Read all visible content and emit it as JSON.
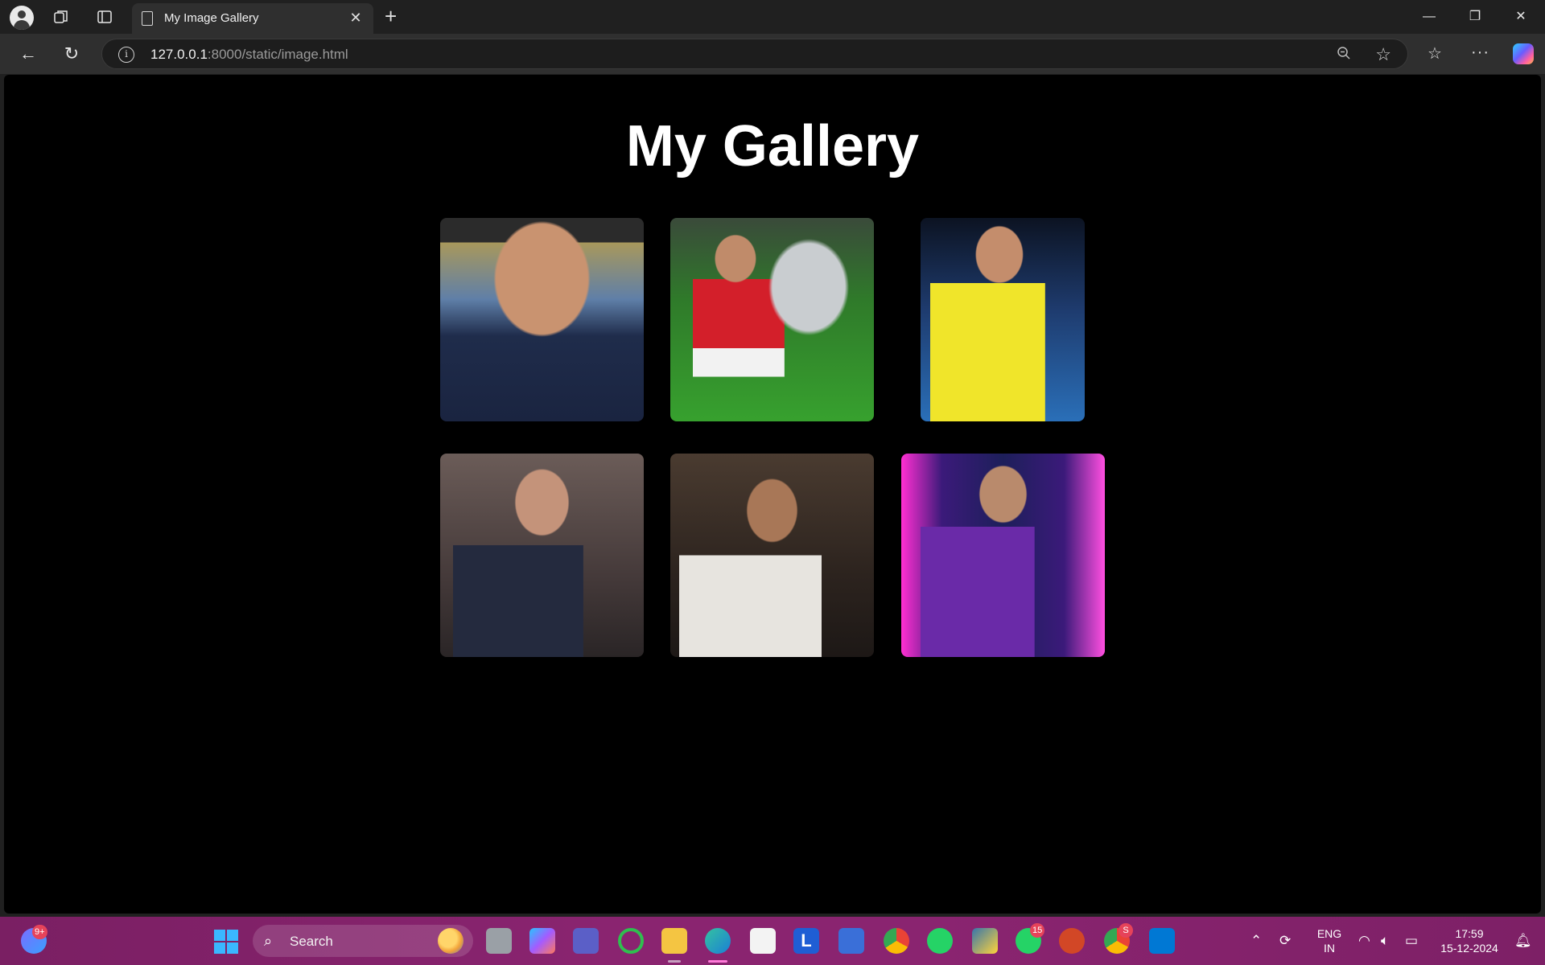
{
  "browser": {
    "tab_title": "My Image Gallery",
    "url_host": "127.0.0.1",
    "url_rest": ":8000/static/image.html",
    "window_controls": {
      "minimize": "—",
      "restore": "❐",
      "close": "✕"
    }
  },
  "page": {
    "title": "My Gallery",
    "images": [
      {
        "id": "img1"
      },
      {
        "id": "img2"
      },
      {
        "id": "img3"
      },
      {
        "id": "img4"
      },
      {
        "id": "img5"
      },
      {
        "id": "img6"
      }
    ]
  },
  "taskbar": {
    "search_label": "Search",
    "chat_badge": "9+",
    "whatsapp_badge": "15",
    "chrome_badge": "S",
    "language_line1": "ENG",
    "language_line2": "IN",
    "time": "17:59",
    "date": "15-12-2024"
  },
  "colors": {
    "page_background": "#000000",
    "title_color": "#ffffff",
    "taskbar": "#8a2470"
  }
}
